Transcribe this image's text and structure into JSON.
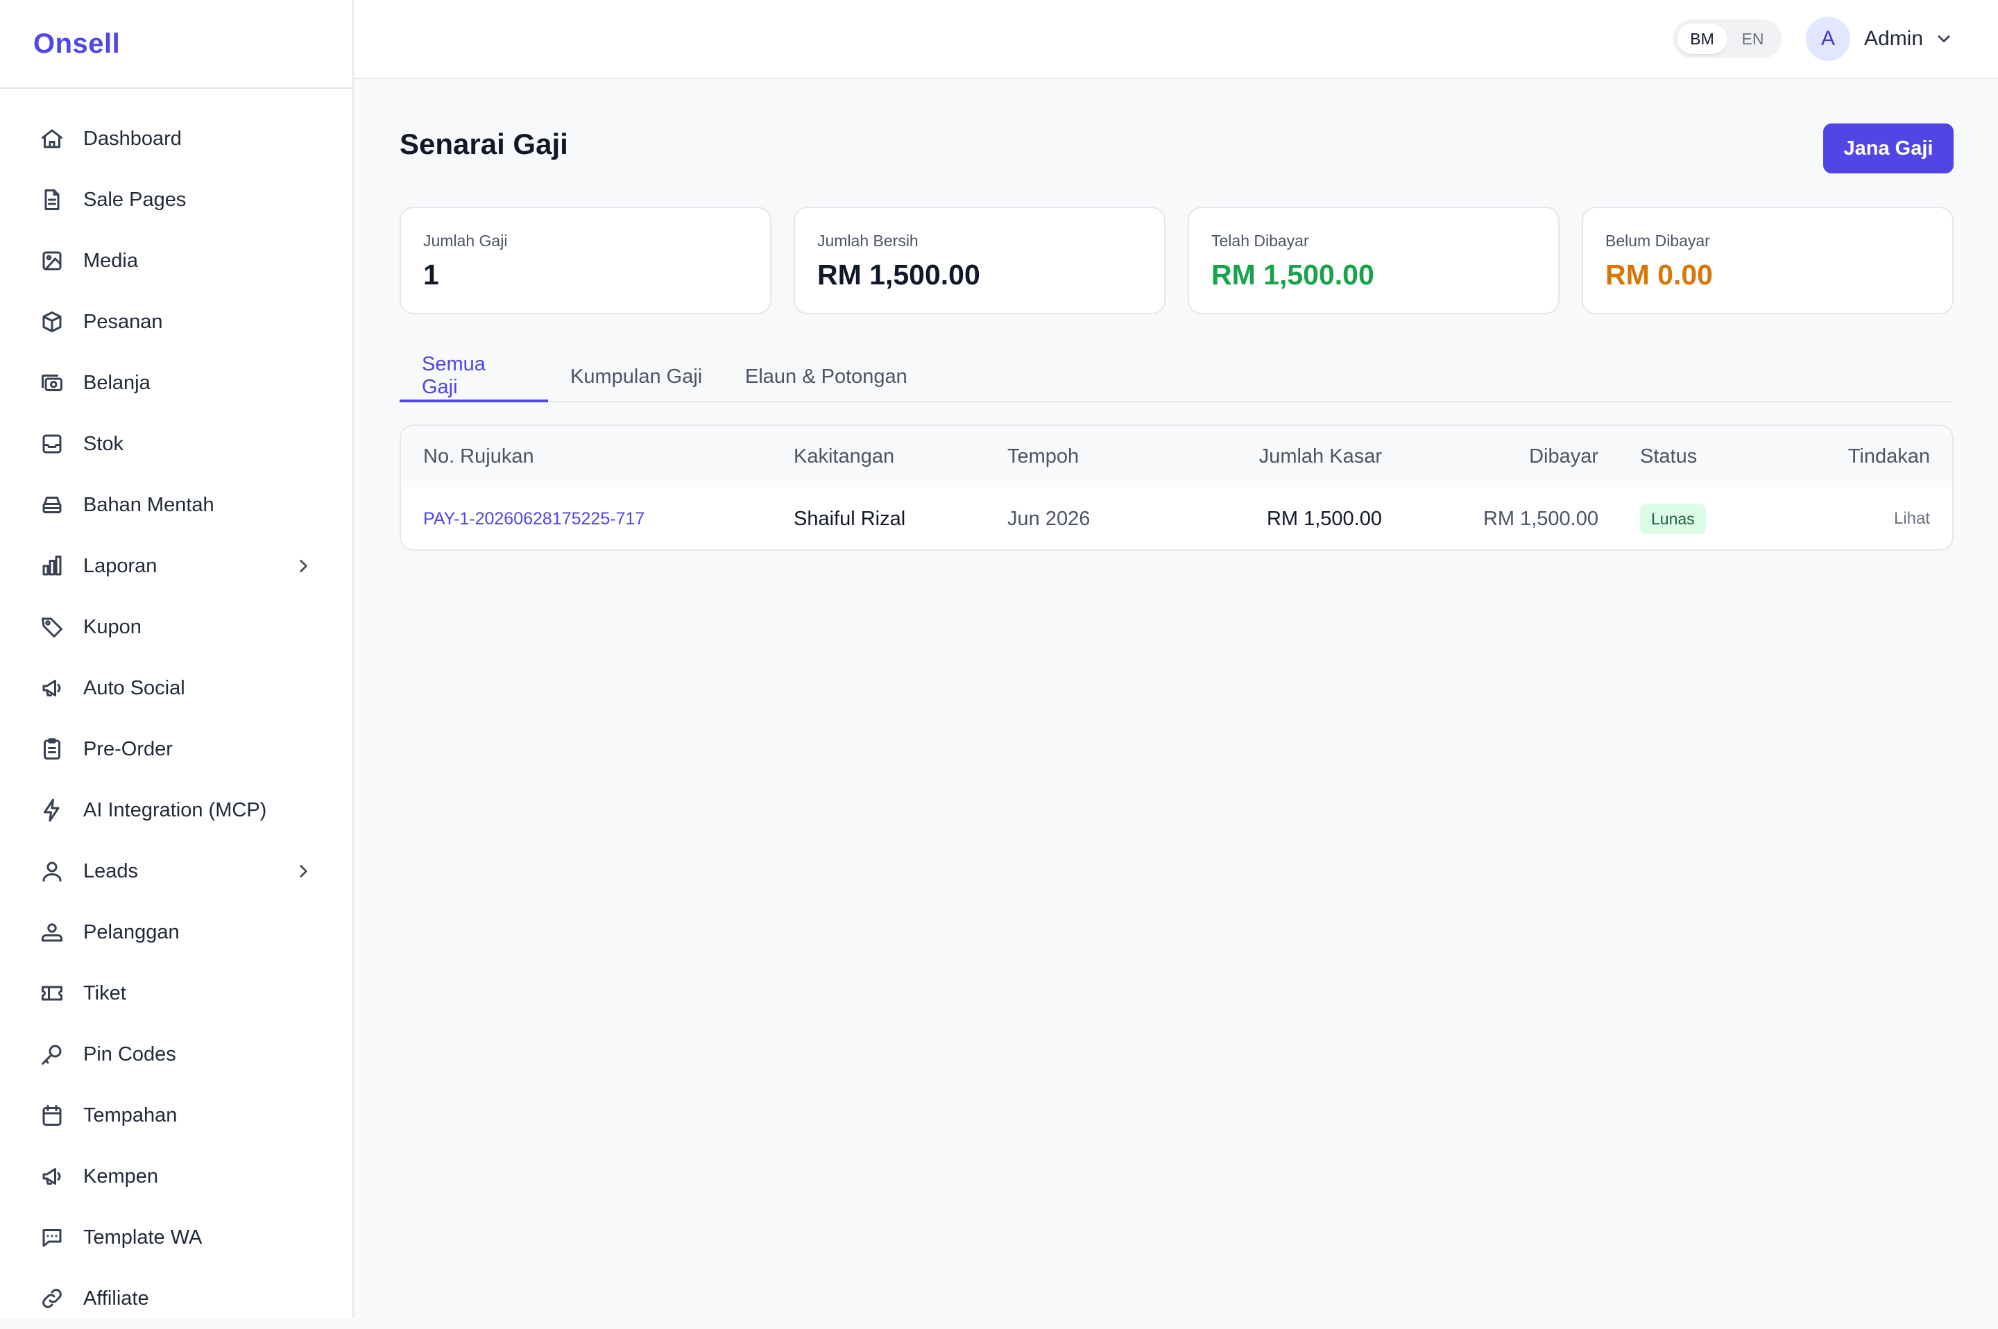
{
  "brand": {
    "name": "Onsell",
    "color": "#4f46e5"
  },
  "sidebar": {
    "items": [
      {
        "label": "Dashboard",
        "icon": "home-icon"
      },
      {
        "label": "Sale Pages",
        "icon": "document-icon"
      },
      {
        "label": "Media",
        "icon": "image-icon"
      },
      {
        "label": "Pesanan",
        "icon": "box-icon"
      },
      {
        "label": "Belanja",
        "icon": "cash-icon"
      },
      {
        "label": "Stok",
        "icon": "inbox-icon"
      },
      {
        "label": "Bahan Mentah",
        "icon": "archive-icon"
      },
      {
        "label": "Laporan",
        "icon": "bar-chart-icon",
        "has_submenu": true
      },
      {
        "label": "Kupon",
        "icon": "tag-icon"
      },
      {
        "label": "Auto Social",
        "icon": "megaphone-icon"
      },
      {
        "label": "Pre-Order",
        "icon": "clipboard-icon"
      },
      {
        "label": "AI Integration (MCP)",
        "icon": "bolt-icon"
      },
      {
        "label": "Leads",
        "icon": "user-icon",
        "has_submenu": true
      },
      {
        "label": "Pelanggan",
        "icon": "users-icon"
      },
      {
        "label": "Tiket",
        "icon": "ticket-icon"
      },
      {
        "label": "Pin Codes",
        "icon": "key-icon"
      },
      {
        "label": "Tempahan",
        "icon": "calendar-icon"
      },
      {
        "label": "Kempen",
        "icon": "megaphone-icon"
      },
      {
        "label": "Template WA",
        "icon": "chat-icon"
      },
      {
        "label": "Affiliate",
        "icon": "link-icon"
      }
    ]
  },
  "topbar": {
    "languages": [
      {
        "label": "BM",
        "active": true
      },
      {
        "label": "EN",
        "active": false
      }
    ],
    "user": {
      "initial": "A",
      "name": "Admin"
    }
  },
  "main": {
    "title": "Senarai Gaji",
    "generate_button": "Jana Gaji",
    "stats": [
      {
        "label": "Jumlah Gaji",
        "value": "1",
        "color": "#111827"
      },
      {
        "label": "Jumlah Bersih",
        "value": "RM 1,500.00",
        "color": "#111827"
      },
      {
        "label": "Telah Dibayar",
        "value": "RM 1,500.00",
        "color": "#16a34a"
      },
      {
        "label": "Belum Dibayar",
        "value": "RM 0.00",
        "color": "#d97706"
      }
    ],
    "tabs": [
      {
        "label": "Semua Gaji",
        "active": true
      },
      {
        "label": "Kumpulan Gaji",
        "active": false
      },
      {
        "label": "Elaun & Potongan",
        "active": false
      }
    ],
    "table": {
      "columns": [
        "No. Rujukan",
        "Kakitangan",
        "Tempoh",
        "Jumlah Kasar",
        "Dibayar",
        "Status",
        "Tindakan"
      ],
      "rows": [
        {
          "reference": "PAY-1-20260628175225-717",
          "employee": "Shaiful Rizal",
          "period": "Jun 2026",
          "gross": "RM 1,500.00",
          "paid": "RM 1,500.00",
          "status": "Lunas",
          "action": "Lihat"
        }
      ]
    }
  }
}
